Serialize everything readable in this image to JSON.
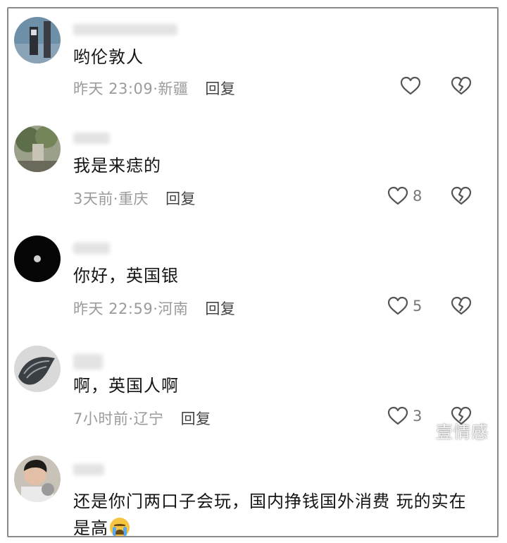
{
  "comments": [
    {
      "text": "哟伦敦人",
      "time": "昨天 23:09",
      "location": "新疆",
      "reply": "回复",
      "likes": ""
    },
    {
      "text": "我是来痣的",
      "time": "3天前",
      "location": "重庆",
      "reply": "回复",
      "likes": "8"
    },
    {
      "text": "你好，英国银",
      "time": "昨天 22:59",
      "location": "河南",
      "reply": "回复",
      "likes": "5"
    },
    {
      "text": "啊，英国人啊",
      "time": "7小时前",
      "location": "辽宁",
      "reply": "回复",
      "likes": "3"
    },
    {
      "text": "还是你门两口子会玩，国内挣钱国外消费 玩的实在是高",
      "emoji": "loudly-crying-face-emoji"
    }
  ],
  "separator": "·",
  "watermark": "壹情感",
  "icons": {
    "like": "heart-outline-icon",
    "dislike": "broken-heart-icon"
  }
}
